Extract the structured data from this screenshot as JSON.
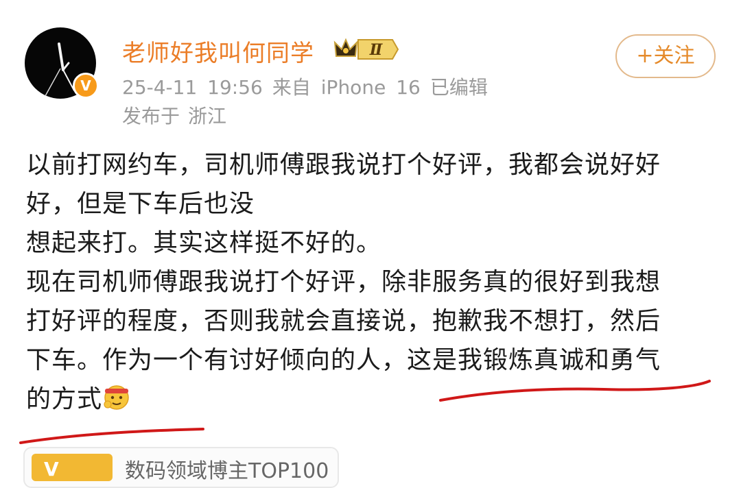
{
  "header": {
    "username": "老师好我叫何同学",
    "member_level": "Ⅱ",
    "verified_mark": "V",
    "date": "25-4-11 19:56",
    "source": "来自 iPhone 16",
    "edited": "已编辑",
    "location_prefix": "发布于",
    "location": "浙江",
    "follow_label": "+关注"
  },
  "post": {
    "lines": [
      "以前打网约车，司机师傅跟我说打个好评，我都会说好好",
      "好，但是下车后也没",
      "想起来打。其实这样挺不好的。",
      "现在司机师傅跟我说打个好评，除非服务真的很好到我想",
      "打好评的程度，否则我就会直接说，抱歉我不想打，然后",
      "下车。作为一个有讨好倾向的人，这是我锻炼真诚和勇气",
      "的方式"
    ],
    "emoji": "effort-emoji"
  },
  "bottom_card": {
    "badge_letter": "V",
    "text": "数码领域博主TOP100"
  },
  "colors": {
    "username": "#eb7d27",
    "meta": "#9a9a9a",
    "follow_border": "#e3b98b",
    "annotation": "#d01818",
    "badge_orange": "#f79a1a"
  }
}
